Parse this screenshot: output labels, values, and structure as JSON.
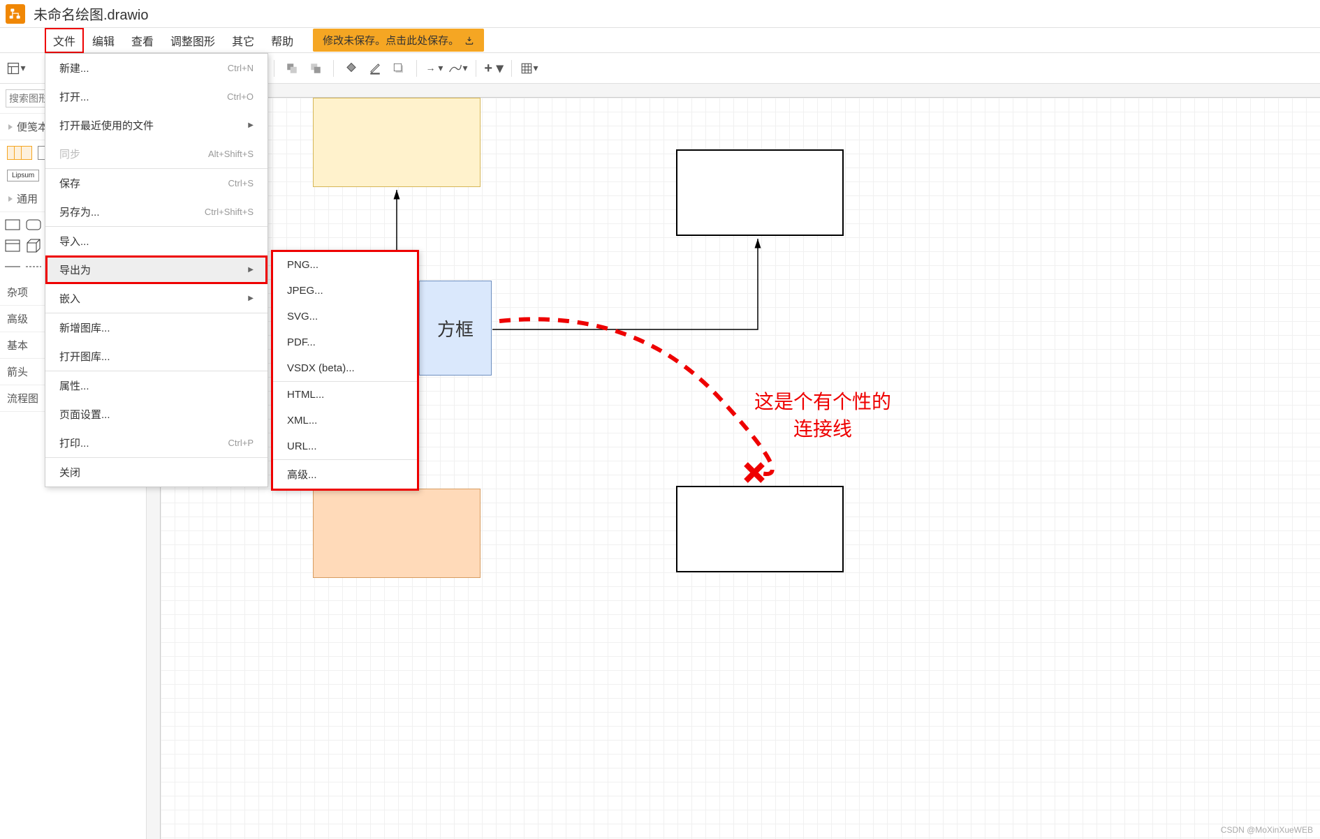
{
  "app": {
    "title": "未命名绘图.drawio"
  },
  "menubar": {
    "items": [
      "文件",
      "编辑",
      "查看",
      "调整图形",
      "其它",
      "帮助"
    ],
    "save_banner": "修改未保存。点击此处保存。"
  },
  "file_menu": {
    "items": [
      {
        "label": "新建...",
        "shortcut": "Ctrl+N"
      },
      {
        "label": "打开...",
        "shortcut": "Ctrl+O"
      },
      {
        "label": "打开最近使用的文件",
        "submenu": true
      },
      {
        "label": "同步",
        "shortcut": "Alt+Shift+S",
        "disabled": true
      },
      {
        "divider": true
      },
      {
        "label": "保存",
        "shortcut": "Ctrl+S"
      },
      {
        "label": "另存为...",
        "shortcut": "Ctrl+Shift+S"
      },
      {
        "divider": true
      },
      {
        "label": "导入..."
      },
      {
        "label": "导出为",
        "submenu": true,
        "highlighted": true
      },
      {
        "label": "嵌入",
        "submenu": true
      },
      {
        "divider": true
      },
      {
        "label": "新增图库..."
      },
      {
        "label": "打开图库..."
      },
      {
        "divider": true
      },
      {
        "label": "属性..."
      },
      {
        "label": "页面设置..."
      },
      {
        "label": "打印...",
        "shortcut": "Ctrl+P"
      },
      {
        "divider": true
      },
      {
        "label": "关闭"
      }
    ]
  },
  "export_menu": {
    "items": [
      "PNG...",
      "JPEG...",
      "SVG...",
      "PDF...",
      "VSDX (beta)...",
      "HTML...",
      "XML...",
      "URL...",
      "高级..."
    ]
  },
  "sidebar": {
    "search_placeholder": "搜索图形",
    "sections": [
      "便笺本",
      "通用",
      "杂项",
      "高级",
      "基本",
      "箭头",
      "流程图"
    ],
    "example_label": "Lipsum"
  },
  "canvas": {
    "box_label": "方框",
    "annotation_line1": "这是个有个性的",
    "annotation_line2": "连接线"
  },
  "watermark": "CSDN @MoXinXueWEB"
}
